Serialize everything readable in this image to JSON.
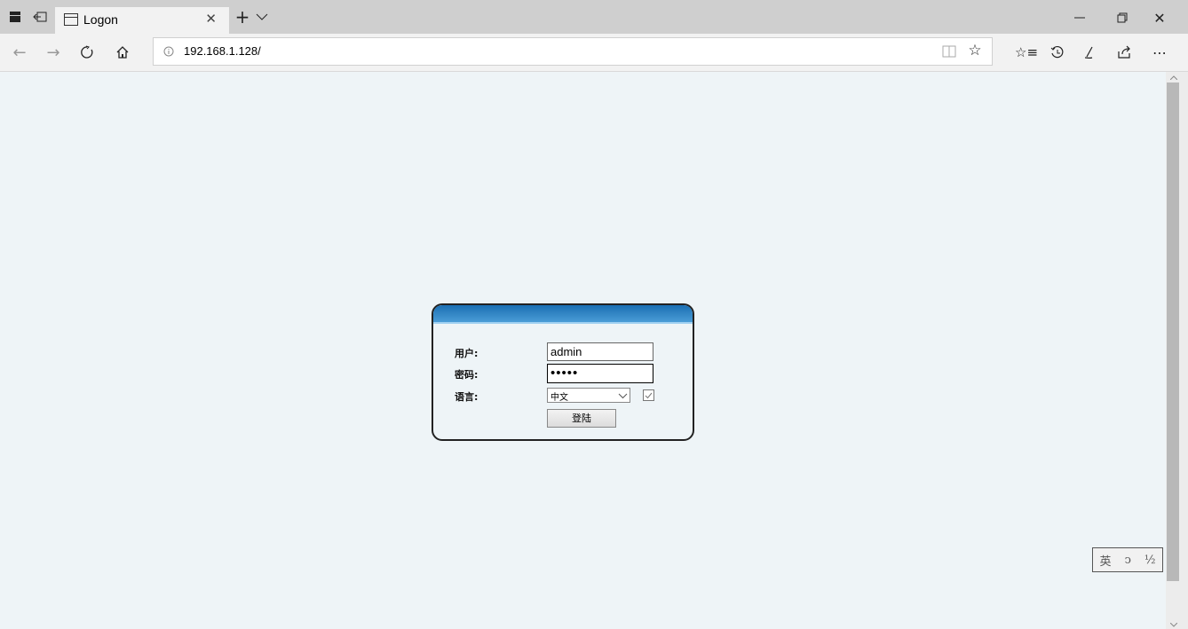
{
  "tab": {
    "title": "Logon"
  },
  "address_bar": {
    "url": "192.168.1.128/"
  },
  "login": {
    "user_label": "用户:",
    "user_value": "admin",
    "password_label": "密码:",
    "password_value": "•••••",
    "language_label": "语言:",
    "language_selected": "中文",
    "submit_label": "登陆"
  },
  "ime_toolbar": {
    "mode": "英",
    "punct": "ↄ",
    "width": "½"
  },
  "icons": {
    "tab_actions": "tab-actions-icon",
    "set_aside": "set-aside-tabs-icon",
    "page": "page-icon",
    "back": "back-icon",
    "forward": "forward-icon",
    "refresh": "refresh-icon",
    "home": "home-icon",
    "site_info": "info-icon",
    "reading_view": "reading-view-icon",
    "favorite": "star-icon",
    "favorites_hub": "favorites-icon",
    "history": "history-icon",
    "notes": "pen-icon",
    "share": "share-icon",
    "more": "more-icon"
  }
}
